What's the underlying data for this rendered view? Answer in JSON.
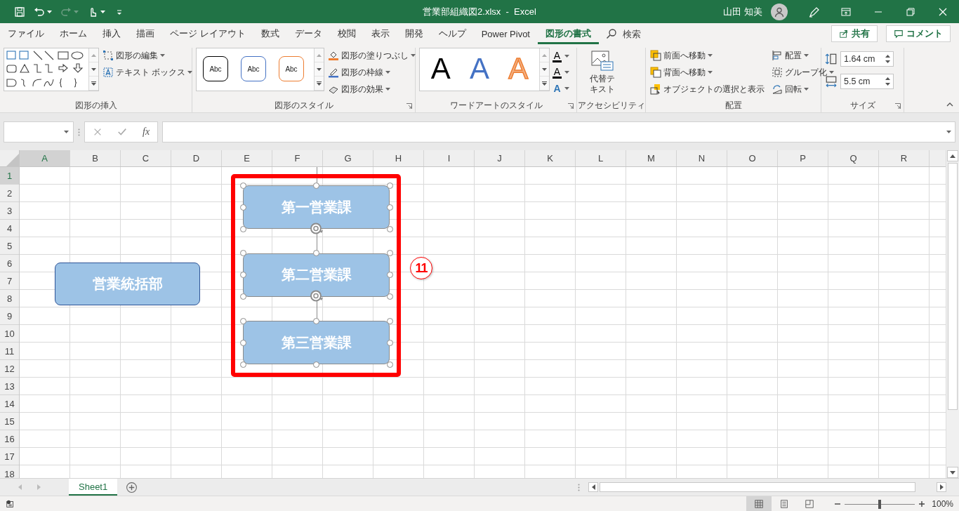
{
  "window": {
    "title": "営業部組織図2.xlsx  -  Excel",
    "user": "山田 知美"
  },
  "ribbon_tabs": [
    {
      "label": "ファイル",
      "selected": false
    },
    {
      "label": "ホーム",
      "selected": false
    },
    {
      "label": "挿入",
      "selected": false
    },
    {
      "label": "描画",
      "selected": false
    },
    {
      "label": "ページ レイアウト",
      "selected": false
    },
    {
      "label": "数式",
      "selected": false
    },
    {
      "label": "データ",
      "selected": false
    },
    {
      "label": "校閲",
      "selected": false
    },
    {
      "label": "表示",
      "selected": false
    },
    {
      "label": "開発",
      "selected": false
    },
    {
      "label": "ヘルプ",
      "selected": false
    },
    {
      "label": "Power Pivot",
      "selected": false
    },
    {
      "label": "図形の書式",
      "selected": true
    }
  ],
  "search": {
    "placeholder": "検索"
  },
  "share_button": {
    "label": "共有"
  },
  "comment_button": {
    "label": "コメント"
  },
  "ribbon_groups": [
    {
      "kind": "insert_shapes",
      "label": "図形の挿入",
      "commands": [
        "図形の編集",
        "テキスト ボックス"
      ]
    },
    {
      "kind": "shape_styles",
      "label": "図形のスタイル",
      "styles": [
        {
          "text": "Abc",
          "color": "#000000"
        },
        {
          "text": "Abc",
          "color": "#4472c4"
        },
        {
          "text": "Abc",
          "color": "#ed7d31"
        }
      ],
      "commands": [
        "図形の塗りつぶし",
        "図形の枠線",
        "図形の効果"
      ]
    },
    {
      "kind": "wordart",
      "label": "ワードアートのスタイル",
      "styles": [
        {
          "text": "A",
          "color": "#000000"
        },
        {
          "text": "A",
          "color": "#4472c4"
        },
        {
          "text": "A",
          "color": "#f4b183"
        }
      ],
      "commands": [
        "A",
        "A",
        "A"
      ]
    },
    {
      "kind": "large_button",
      "label": "アクセシビリティ",
      "button": "代替テキスト"
    },
    {
      "kind": "arrange",
      "label": "配置",
      "commands": [
        "前面へ移動",
        "背面へ移動",
        "オブジェクトの選択と表示",
        "配置",
        "グループ化",
        "回転"
      ]
    },
    {
      "kind": "size",
      "label": "サイズ",
      "fields": [
        "1.64 cm",
        "5.5 cm"
      ]
    }
  ],
  "formula_bar": {
    "function_label": "fx"
  },
  "sheet": {
    "columns": [
      {
        "label": "A",
        "selected": true
      },
      {
        "label": "B",
        "selected": false
      },
      {
        "label": "C",
        "selected": false
      },
      {
        "label": "D",
        "selected": false
      },
      {
        "label": "E",
        "selected": false
      },
      {
        "label": "F",
        "selected": false
      },
      {
        "label": "G",
        "selected": false
      },
      {
        "label": "H",
        "selected": false
      },
      {
        "label": "I",
        "selected": false
      },
      {
        "label": "J",
        "selected": false
      },
      {
        "label": "K",
        "selected": false
      },
      {
        "label": "L",
        "selected": false
      },
      {
        "label": "M",
        "selected": false
      },
      {
        "label": "N",
        "selected": false
      },
      {
        "label": "O",
        "selected": false
      },
      {
        "label": "P",
        "selected": false
      },
      {
        "label": "Q",
        "selected": false
      },
      {
        "label": "R",
        "selected": false
      }
    ],
    "rows": [
      {
        "label": "1",
        "selected": true
      },
      {
        "label": "2",
        "selected": false
      },
      {
        "label": "3",
        "selected": false
      },
      {
        "label": "4",
        "selected": false
      },
      {
        "label": "5",
        "selected": false
      },
      {
        "label": "6",
        "selected": false
      },
      {
        "label": "7",
        "selected": false
      },
      {
        "label": "8",
        "selected": false
      },
      {
        "label": "9",
        "selected": false
      },
      {
        "label": "10",
        "selected": false
      },
      {
        "label": "11",
        "selected": false
      },
      {
        "label": "12",
        "selected": false
      },
      {
        "label": "13",
        "selected": false
      },
      {
        "label": "14",
        "selected": false
      },
      {
        "label": "15",
        "selected": false
      },
      {
        "label": "16",
        "selected": false
      },
      {
        "label": "17",
        "selected": false
      },
      {
        "label": "18",
        "selected": false
      }
    ]
  },
  "org_chart": {
    "head": {
      "text": "営業統括部"
    },
    "sections": [
      {
        "text": "第一営業課",
        "selected": true
      },
      {
        "text": "第二営業課",
        "selected": true
      },
      {
        "text": "第三営業課",
        "selected": true
      }
    ],
    "callout": "11"
  },
  "sheet_tabs": [
    {
      "label": "Sheet1",
      "selected": true
    }
  ],
  "status_bar": {
    "views": [
      {
        "kind": "normal",
        "selected": true
      },
      {
        "kind": "page_layout",
        "selected": false
      },
      {
        "kind": "page_break",
        "selected": false
      }
    ],
    "zoom_slider": {
      "level": 0.5
    },
    "zoom": "100%"
  }
}
